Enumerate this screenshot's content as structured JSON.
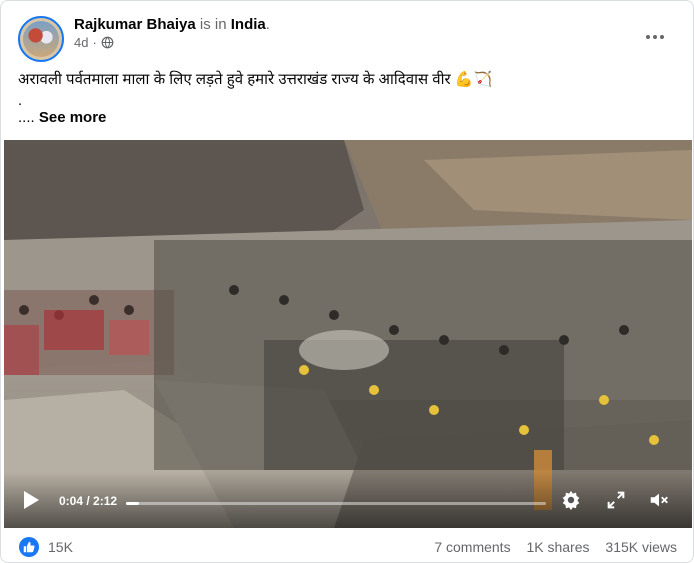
{
  "post": {
    "author": "Rajkumar Bhaiya",
    "is_in": "is in",
    "place": "India",
    "period": ".",
    "time_ago": "4d",
    "text": "अरावली पर्वतमाला माला के लिए लड़ते हुवे हमारे उत्तराखंड राज्य के आदिवास वीर",
    "text_emoji": "💪🏹",
    "dot_line": ".",
    "ellipsis": "....",
    "see_more": "See more"
  },
  "video": {
    "time_display": "0:04 / 2:12",
    "progress_fraction": 0.03,
    "icons": [
      "play-icon",
      "settings-icon",
      "fullscreen-icon",
      "volume-icon"
    ]
  },
  "footer": {
    "like_count": "15K",
    "comments": "7 comments",
    "shares": "1K shares",
    "views": "315K views"
  },
  "colors": {
    "accent": "#1877f2",
    "secondary_text": "#65676b"
  }
}
